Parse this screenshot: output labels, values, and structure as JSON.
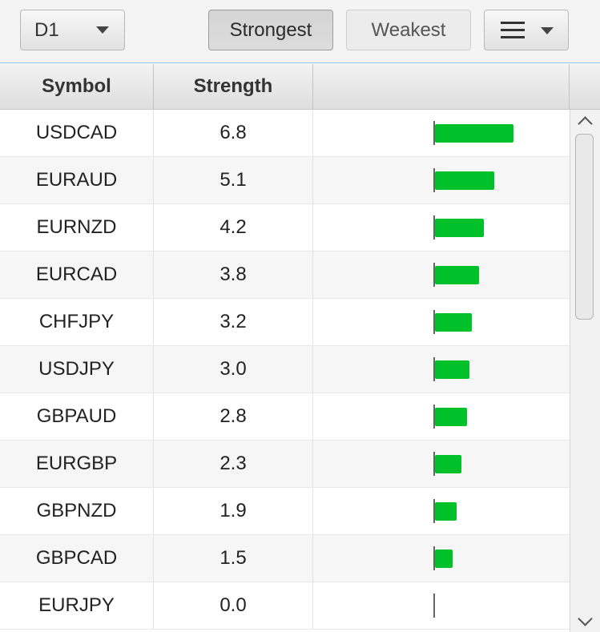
{
  "toolbar": {
    "timeframe": "D1",
    "strongest_label": "Strongest",
    "weakest_label": "Weakest",
    "menu_icon": "hamburger-menu-icon"
  },
  "table": {
    "columns": [
      "Symbol",
      "Strength",
      ""
    ],
    "max_strength": 6.8,
    "bar_color": "#00c12a",
    "rows": [
      {
        "symbol": "USDCAD",
        "strength": "6.8"
      },
      {
        "symbol": "EURAUD",
        "strength": "5.1"
      },
      {
        "symbol": "EURNZD",
        "strength": "4.2"
      },
      {
        "symbol": "EURCAD",
        "strength": "3.8"
      },
      {
        "symbol": "CHFJPY",
        "strength": "3.2"
      },
      {
        "symbol": "USDJPY",
        "strength": "3.0"
      },
      {
        "symbol": "GBPAUD",
        "strength": "2.8"
      },
      {
        "symbol": "EURGBP",
        "strength": "2.3"
      },
      {
        "symbol": "GBPNZD",
        "strength": "1.9"
      },
      {
        "symbol": "GBPCAD",
        "strength": "1.5"
      },
      {
        "symbol": "EURJPY",
        "strength": "0.0"
      }
    ]
  }
}
